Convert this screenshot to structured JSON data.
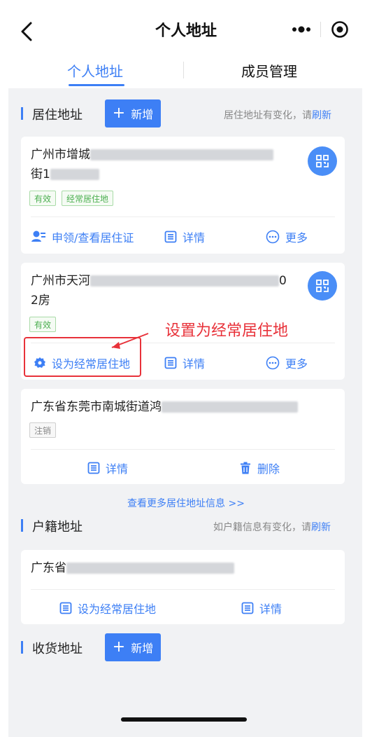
{
  "header": {
    "title": "个人地址",
    "back_icon": "chevron-left-icon",
    "more_icon": "more-dots-icon",
    "close_icon": "record-circle-icon"
  },
  "tabs": [
    {
      "label": "个人地址",
      "active": true
    },
    {
      "label": "成员管理",
      "active": false
    }
  ],
  "residence": {
    "title": "居住地址",
    "add_label": "新增",
    "hint_prefix": "居住地址有变化，请",
    "hint_link": "刷新",
    "cards": [
      {
        "address_line1": "广州市增城",
        "address_line2": "街1",
        "tags": [
          "有效",
          "经常居住地"
        ],
        "actions": [
          "申领/查看居住证",
          "详情",
          "更多"
        ]
      },
      {
        "address_line1": "广州市天河",
        "address_line1_end": "0",
        "address_line2": "2房",
        "tags": [
          "有效"
        ],
        "actions": [
          "设为经常居住地",
          "详情",
          "更多"
        ]
      },
      {
        "address_line1": "广东省东莞市南城街道鸿",
        "tags": [
          "注销"
        ],
        "actions": [
          "详情",
          "删除"
        ]
      }
    ],
    "more_link": "查看更多居住地址信息 >>"
  },
  "household": {
    "title": "户籍地址",
    "hint_prefix": "如户籍信息有变化，请",
    "hint_link": "刷新",
    "card": {
      "address_line1": "广东省",
      "actions": [
        "设为经常居住地",
        "详情"
      ]
    }
  },
  "shipping": {
    "title": "收货地址",
    "add_label": "新增"
  },
  "annotation": {
    "text": "设置为经常居住地",
    "color": "#e8323a"
  },
  "colors": {
    "accent": "#3d7ff5",
    "background": "#f1f2f4",
    "valid_tag": "#4caf50"
  }
}
